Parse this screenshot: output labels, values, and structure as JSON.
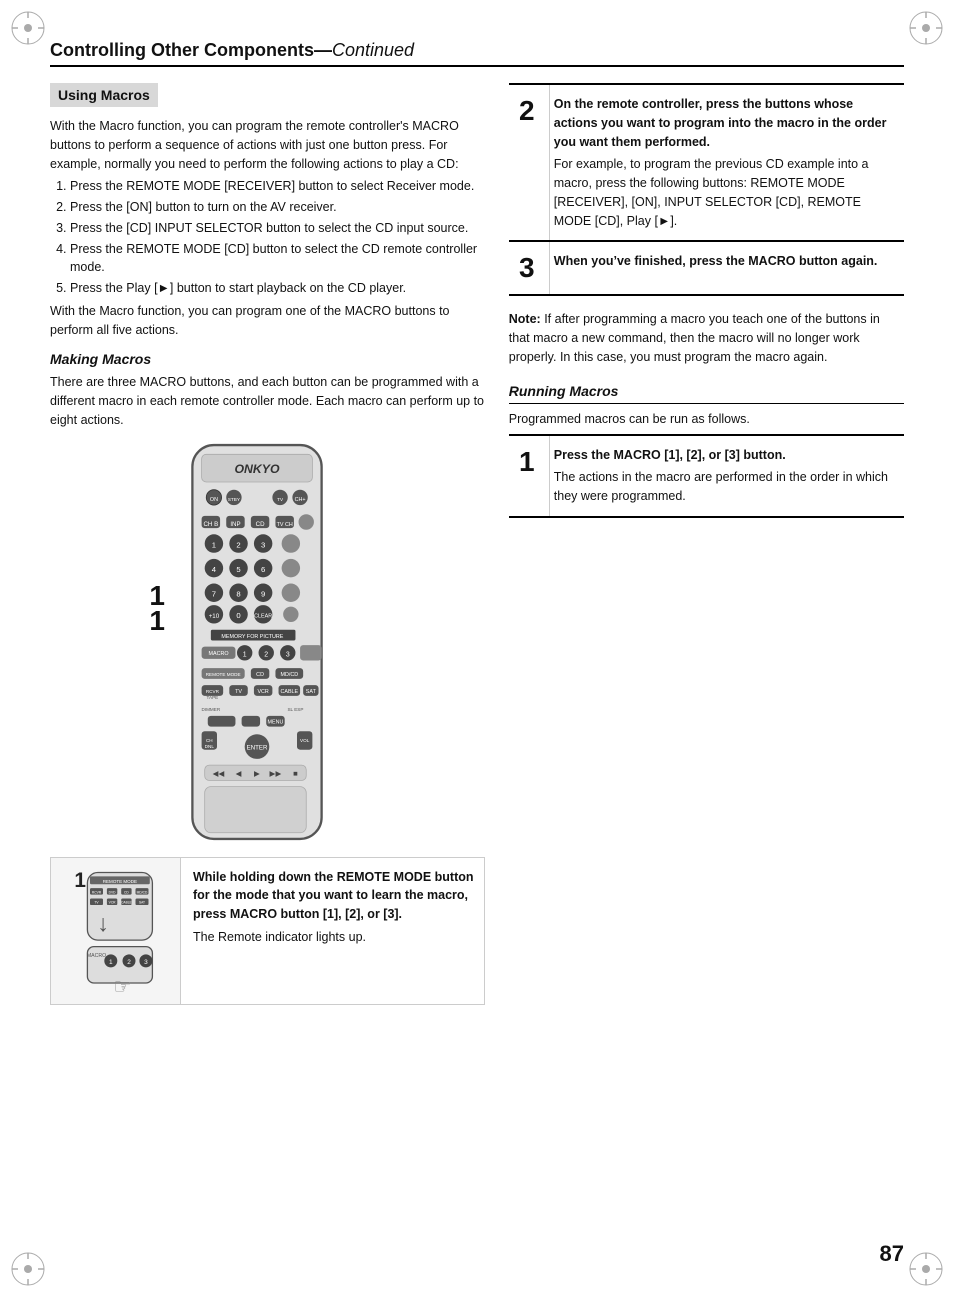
{
  "page": {
    "number": "87",
    "header": {
      "title": "Controlling Other Components",
      "subtitle": "Continued"
    }
  },
  "left_column": {
    "using_macros": {
      "heading": "Using Macros",
      "body_p1": "With the Macro function, you can program the remote controller's MACRO buttons to perform a sequence of actions with just one button press. For example, normally you need to perform the following actions to play a CD:",
      "steps": [
        "Press the REMOTE MODE [RECEIVER] button to select Receiver mode.",
        "Press the [ON] button to turn on the AV receiver.",
        "Press the [CD] INPUT SELECTOR button to select the CD input source.",
        "Press the REMOTE MODE [CD] button to select the CD remote controller mode.",
        "Press the Play [►] button to start playback on the CD player."
      ],
      "body_p2": "With the Macro function, you can program one of the MACRO buttons to perform all five actions."
    },
    "making_macros": {
      "heading": "Making Macros",
      "body": "There are three MACRO buttons, and each button can be programmed with a different macro in each remote controller mode. Each macro can perform up to eight actions.",
      "label_1": "1",
      "label_2": "1"
    },
    "bottom_step": {
      "step_number": "1",
      "bold_text": "While holding down the REMOTE MODE button for the mode that you want to learn the macro, press MACRO button [1], [2], or [3].",
      "body_text": "The Remote indicator lights up."
    }
  },
  "right_column": {
    "step2": {
      "number": "2",
      "bold": "On the remote controller, press the buttons whose actions you want to program into the macro in the order you want them performed.",
      "body": "For example, to program the previous CD example into a macro, press the following buttons: REMOTE MODE [RECEIVER], [ON], INPUT SELECTOR [CD], REMOTE MODE [CD], Play [►]."
    },
    "step3": {
      "number": "3",
      "bold": "When you’ve finished, press the MACRO button again."
    },
    "note": {
      "label": "Note:",
      "body": "If after programming a macro you teach one of the buttons in that macro a new command, then the macro will no longer work properly. In this case, you must program the macro again."
    },
    "running_macros": {
      "heading": "Running Macros",
      "intro": "Programmed macros can be run as follows.",
      "step1": {
        "number": "1",
        "bold": "Press the MACRO [1], [2], or [3] button.",
        "body": "The actions in the macro are performed in the order in which they were programmed."
      }
    }
  }
}
